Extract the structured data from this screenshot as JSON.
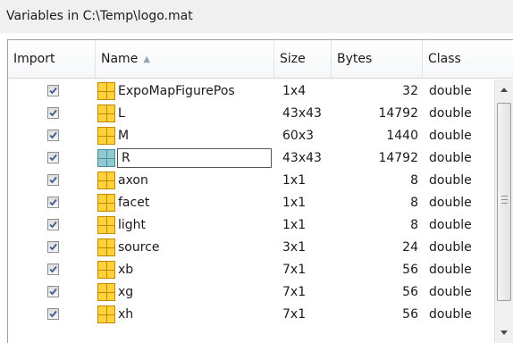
{
  "window": {
    "title": "Variables in C:\\Temp\\logo.mat"
  },
  "table": {
    "columns": {
      "import": "Import",
      "name": "Name",
      "size": "Size",
      "bytes": "Bytes",
      "class": "Class"
    },
    "sort_column": "Name",
    "sort_direction": "ascending",
    "icon": "matrix-variable-icon",
    "rows": [
      {
        "import": true,
        "name": "ExpoMapFigurePos",
        "size": "1x4",
        "bytes": "32",
        "class": "double",
        "editing": false
      },
      {
        "import": true,
        "name": "L",
        "size": "43x43",
        "bytes": "14792",
        "class": "double",
        "editing": false
      },
      {
        "import": true,
        "name": "M",
        "size": "60x3",
        "bytes": "1440",
        "class": "double",
        "editing": false
      },
      {
        "import": true,
        "name": "R",
        "size": "43x43",
        "bytes": "14792",
        "class": "double",
        "editing": true
      },
      {
        "import": true,
        "name": "axon",
        "size": "1x1",
        "bytes": "8",
        "class": "double",
        "editing": false
      },
      {
        "import": true,
        "name": "facet",
        "size": "1x1",
        "bytes": "8",
        "class": "double",
        "editing": false
      },
      {
        "import": true,
        "name": "light",
        "size": "1x1",
        "bytes": "8",
        "class": "double",
        "editing": false
      },
      {
        "import": true,
        "name": "source",
        "size": "3x1",
        "bytes": "24",
        "class": "double",
        "editing": false
      },
      {
        "import": true,
        "name": "xb",
        "size": "7x1",
        "bytes": "56",
        "class": "double",
        "editing": false
      },
      {
        "import": true,
        "name": "xg",
        "size": "7x1",
        "bytes": "56",
        "class": "double",
        "editing": false
      },
      {
        "import": true,
        "name": "xh",
        "size": "7x1",
        "bytes": "56",
        "class": "double",
        "editing": false
      }
    ]
  },
  "colors": {
    "checkmark": "#3b5a8c",
    "icon_fill": "#ffd23a",
    "icon_selected_fill": "#8ecad0"
  }
}
